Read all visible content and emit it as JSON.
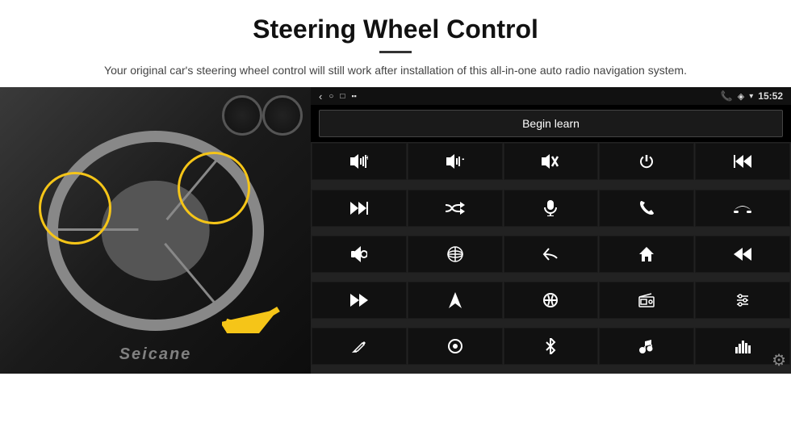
{
  "header": {
    "title": "Steering Wheel Control",
    "subtitle": "Your original car's steering wheel control will still work after installation of this all-in-one auto radio navigation system."
  },
  "status_bar": {
    "back_arrow": "‹",
    "nav_icons": "○  □",
    "signal_icons": "▪▪",
    "phone_icon": "📞",
    "location_icon": "◈",
    "wifi_icon": "▼",
    "time": "15:52"
  },
  "learn_button": {
    "label": "Begin learn"
  },
  "controls": [
    {
      "icon": "🔊+",
      "label": "vol-up"
    },
    {
      "icon": "🔊-",
      "label": "vol-down"
    },
    {
      "icon": "🔇",
      "label": "mute"
    },
    {
      "icon": "⏻",
      "label": "power"
    },
    {
      "icon": "⏮",
      "label": "prev-track"
    },
    {
      "icon": "⏭",
      "label": "next"
    },
    {
      "icon": "⏩",
      "label": "fast-forward"
    },
    {
      "icon": "🎙",
      "label": "mic"
    },
    {
      "icon": "📞",
      "label": "call"
    },
    {
      "icon": "↩",
      "label": "hang-up"
    },
    {
      "icon": "📢",
      "label": "speaker"
    },
    {
      "icon": "🔄",
      "label": "360"
    },
    {
      "icon": "↺",
      "label": "back"
    },
    {
      "icon": "🏠",
      "label": "home"
    },
    {
      "icon": "⏮⏮",
      "label": "rewind"
    },
    {
      "icon": "⏭⏭",
      "label": "skip"
    },
    {
      "icon": "▶",
      "label": "nav"
    },
    {
      "icon": "⇌",
      "label": "eq"
    },
    {
      "icon": "📻",
      "label": "radio"
    },
    {
      "icon": "🎛",
      "label": "settings"
    },
    {
      "icon": "✎",
      "label": "edit"
    },
    {
      "icon": "◎",
      "label": "menu"
    },
    {
      "icon": "✱",
      "label": "bluetooth"
    },
    {
      "icon": "🎵",
      "label": "music"
    },
    {
      "icon": "📊",
      "label": "equalizer"
    }
  ],
  "watermark": "Seicane",
  "gear_icon": "⚙"
}
